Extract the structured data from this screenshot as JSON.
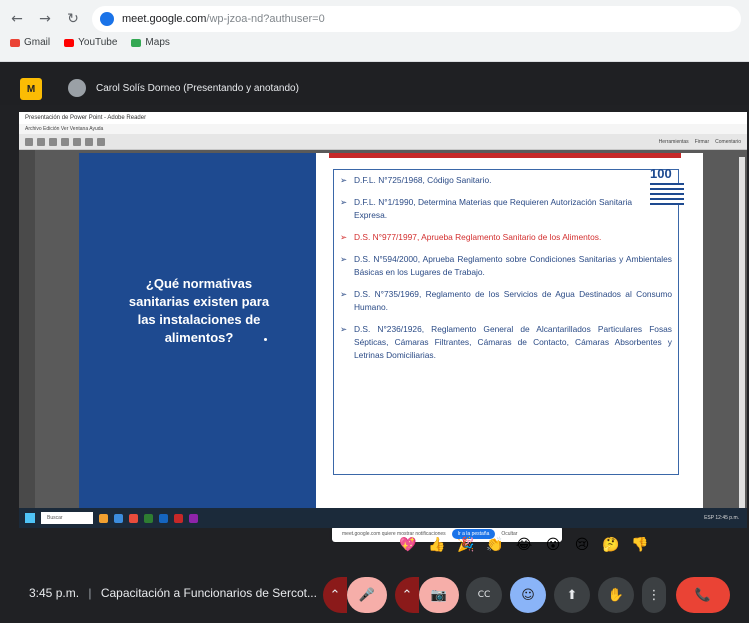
{
  "browser": {
    "url_host": "meet.google.com",
    "url_path": "/wp-jzoa-nd?authuser=0",
    "bookmarks": [
      "Gmail",
      "YouTube",
      "Maps"
    ]
  },
  "presenter": {
    "logo": "M",
    "name": "Carol Solís Dorneo (Presentando y anotando)"
  },
  "pdf": {
    "title": "Presentación de Power Point - Adobe Reader",
    "menu": "Archivo  Edición  Ver  Ventana  Ayuda",
    "tools": [
      "Herramientas",
      "Firmar",
      "Comentario"
    ]
  },
  "slide": {
    "question": "¿Qué normativas sanitarias existen para las instalaciones de alimentos?",
    "logo_number": "100",
    "bullet": "➢",
    "items": [
      {
        "text": "D.F.L. N°725/1968, Código Sanitario.",
        "red": false
      },
      {
        "text": "D.F.L. N°1/1990, Determina Materias que Requieren Autorización Sanitaria Expresa.",
        "red": false
      },
      {
        "text": "D.S. N°977/1997, Aprueba Reglamento Sanitario de los Alimentos.",
        "red": true
      },
      {
        "text": "D.S. N°594/2000, Aprueba Reglamento sobre Condiciones Sanitarias y Ambientales Básicas en los Lugares de Trabajo.",
        "red": false
      },
      {
        "text": "D.S. N°735/1969, Reglamento de los Servicios de Agua Destinados al Consumo Humano.",
        "red": false
      },
      {
        "text": "D.S. N°236/1926, Reglamento General de Alcantarillados Particulares Fosas Sépticas, Cámaras Filtrantes, Cámaras de Contacto, Cámaras Absorbentes y Letrinas Domiciliarias.",
        "red": false
      }
    ],
    "cookie_text": "meet.google.com quiere mostrar notificaciones",
    "cookie_button": "Ir a la pestaña",
    "cookie_dismiss": "Ocultar"
  },
  "taskbar": {
    "search": "Buscar",
    "tray": "ESP  12:45 p.m."
  },
  "reactions": [
    "💖",
    "👍",
    "🎉",
    "👏",
    "😂",
    "😮",
    "😢",
    "🤔",
    "👎"
  ],
  "meeting": {
    "time": "3:45 p.m.",
    "separator": "|",
    "title": "Capacitación a Funcionarios de Sercot..."
  },
  "controls": {
    "chevron": "⌃",
    "mic_off": "🎤",
    "cam_off": "📷",
    "captions": "CC",
    "reaction": "☺",
    "present": "⬆",
    "hand": "✋",
    "more": "⋮",
    "hangup": "📞"
  }
}
